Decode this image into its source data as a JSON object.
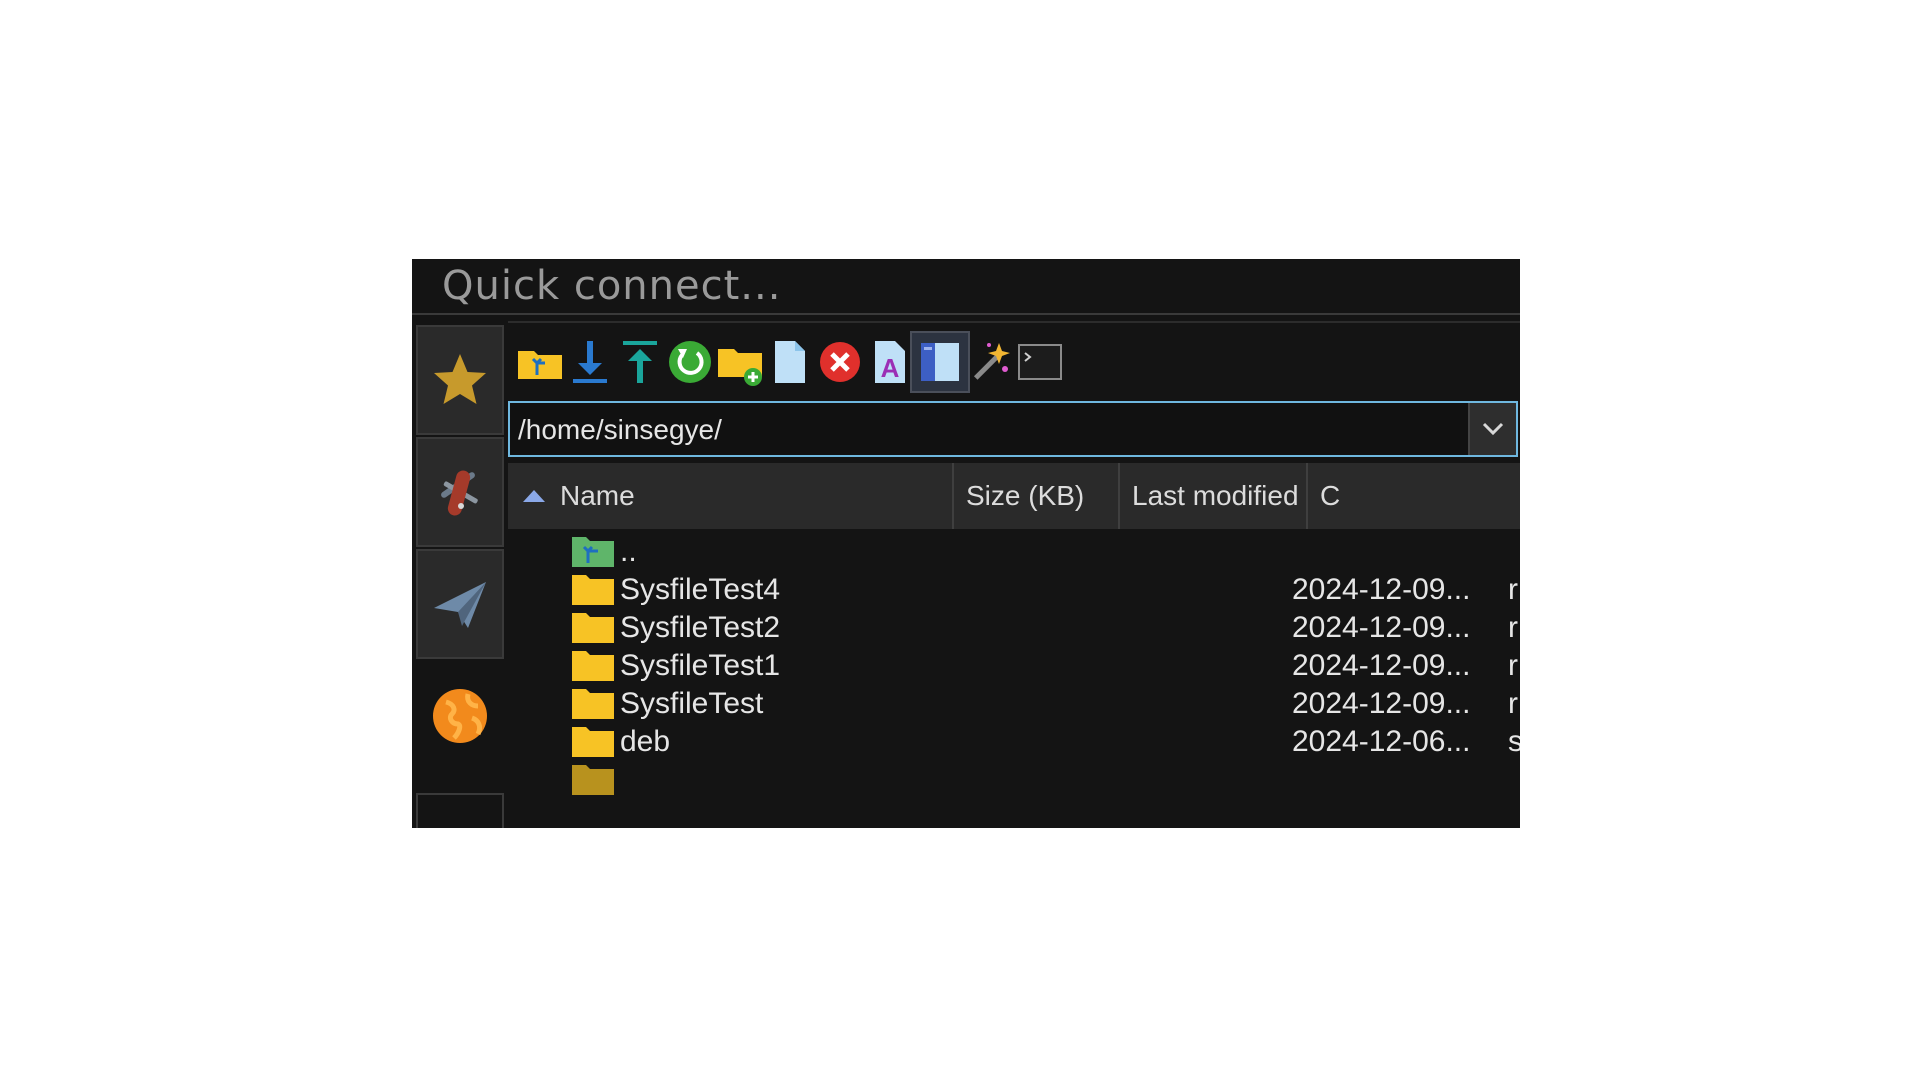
{
  "quick_connect": {
    "placeholder": "Quick connect..."
  },
  "sidebar": {
    "items": [
      {
        "name": "favorites",
        "icon": "star-icon"
      },
      {
        "name": "tools",
        "icon": "swiss-knife-icon"
      },
      {
        "name": "transfers",
        "icon": "paper-plane-icon"
      },
      {
        "name": "servers",
        "icon": "globe-icon"
      }
    ]
  },
  "toolbar": {
    "buttons": [
      {
        "name": "parent-directory",
        "icon": "folder-up-icon"
      },
      {
        "name": "download",
        "icon": "download-icon"
      },
      {
        "name": "upload",
        "icon": "upload-icon"
      },
      {
        "name": "refresh",
        "icon": "refresh-icon"
      },
      {
        "name": "new-folder",
        "icon": "folder-add-icon"
      },
      {
        "name": "new-file",
        "icon": "new-file-icon"
      },
      {
        "name": "delete",
        "icon": "delete-icon"
      },
      {
        "name": "rename",
        "icon": "rename-icon"
      },
      {
        "name": "toggle-panel",
        "icon": "panel-icon"
      },
      {
        "name": "magic",
        "icon": "magic-wand-icon"
      },
      {
        "name": "terminal",
        "icon": "terminal-icon"
      }
    ]
  },
  "path": {
    "value": "/home/sinsegye/"
  },
  "columns": {
    "name": "Name",
    "size": "Size (KB)",
    "modified": "Last modified",
    "permissions": "C"
  },
  "files": [
    {
      "name": "..",
      "type": "parent",
      "modified": "",
      "perm": ""
    },
    {
      "name": "SysfileTest4",
      "type": "folder",
      "modified": "2024-12-09...",
      "perm": "r"
    },
    {
      "name": "SysfileTest2",
      "type": "folder",
      "modified": "2024-12-09...",
      "perm": "r"
    },
    {
      "name": "SysfileTest1",
      "type": "folder",
      "modified": "2024-12-09...",
      "perm": "r"
    },
    {
      "name": "SysfileTest",
      "type": "folder",
      "modified": "2024-12-09...",
      "perm": "r"
    },
    {
      "name": "deb",
      "type": "folder",
      "modified": "2024-12-06...",
      "perm": "s"
    }
  ],
  "colors": {
    "background": "#141414",
    "header": "#2a2a2a",
    "accent": "#6fb8e0",
    "folder": "#f7c325",
    "text": "#e6e6e6"
  }
}
